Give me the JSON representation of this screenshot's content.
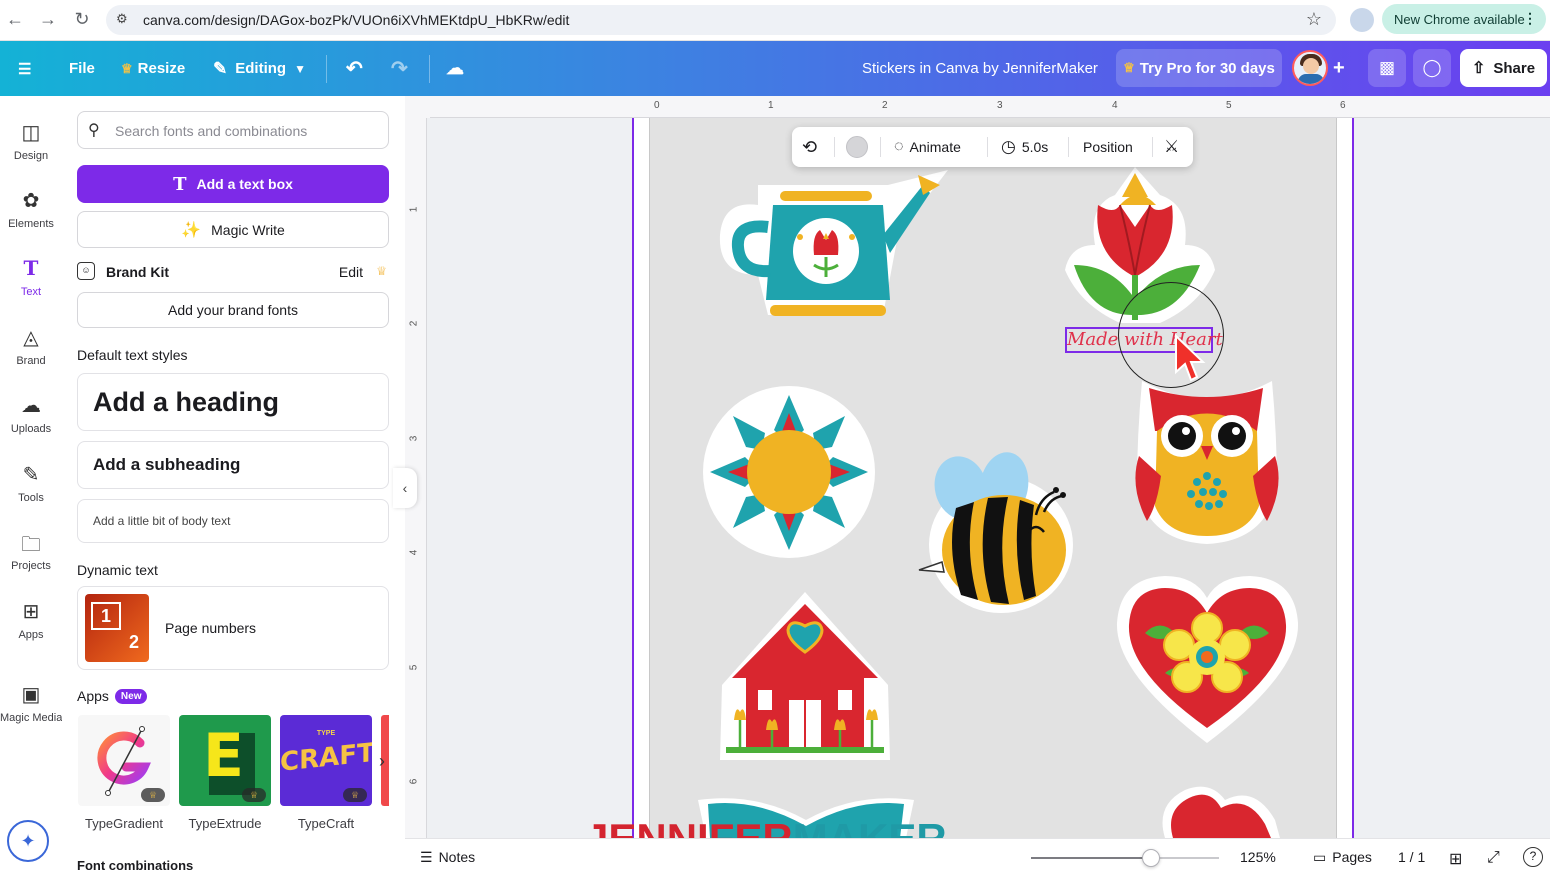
{
  "browser": {
    "url": "canva.com/design/DAGox-bozPk/VUOn6iXVhMEKtdpU_HbKRw/edit",
    "update_label": "New Chrome available"
  },
  "topbar": {
    "file_label": "File",
    "resize_label": "Resize",
    "editing_label": "Editing",
    "design_title": "Stickers in Canva by JenniferMaker",
    "pro_label": "Try Pro for 30 days",
    "share_label": "Share"
  },
  "rail": {
    "items": [
      {
        "label": "Design",
        "icon": "layout-icon"
      },
      {
        "label": "Elements",
        "icon": "shapes-icon"
      },
      {
        "label": "Text",
        "icon": "text-icon"
      },
      {
        "label": "Brand",
        "icon": "brand-icon"
      },
      {
        "label": "Uploads",
        "icon": "cloud-upload-icon"
      },
      {
        "label": "Tools",
        "icon": "pen-icon"
      },
      {
        "label": "Projects",
        "icon": "folder-icon"
      },
      {
        "label": "Apps",
        "icon": "apps-grid-icon"
      },
      {
        "label": "Magic Media",
        "icon": "magic-media-icon"
      }
    ],
    "active": "Text"
  },
  "panel": {
    "search_placeholder": "Search fonts and combinations",
    "add_text_box": "Add a text box",
    "magic_write": "Magic Write",
    "brand_kit": "Brand Kit",
    "brand_kit_edit": "Edit",
    "add_brand_fonts": "Add your brand fonts",
    "default_styles_title": "Default text styles",
    "heading": "Add a heading",
    "subheading": "Add a subheading",
    "body": "Add a little bit of body text",
    "dynamic_title": "Dynamic text",
    "page_numbers": "Page numbers",
    "page_numbers_thumb": [
      "1",
      "2"
    ],
    "apps_title": "Apps",
    "apps_badge": "New",
    "apps": [
      {
        "label": "TypeGradient"
      },
      {
        "label": "TypeExtrude",
        "glyph": "E"
      },
      {
        "label": "TypeCraft",
        "glyph": "CRAFT",
        "small": "TYPE"
      }
    ],
    "font_combinations_title": "Font combinations"
  },
  "rulers": {
    "top": [
      "0",
      "1",
      "2",
      "3",
      "4",
      "5",
      "6"
    ],
    "left": [
      "1",
      "2",
      "3",
      "4",
      "5",
      "6"
    ]
  },
  "context_toolbar": {
    "animate": "Animate",
    "duration": "5.0s",
    "position": "Position"
  },
  "canvas": {
    "selected_text": "Made with Heart",
    "colors": {
      "accent": "#7d2ae8",
      "teal": "#1fa3ad",
      "red": "#d9262f",
      "yellow": "#f0b323",
      "green": "#4caf3a"
    }
  },
  "bottombar": {
    "notes": "Notes",
    "zoom": "125%",
    "zoom_fraction": 0.64,
    "pages": "Pages",
    "page_count": "1 / 1"
  },
  "watermark": {
    "part1": "JENNIFER",
    "part2": "MAKER"
  }
}
